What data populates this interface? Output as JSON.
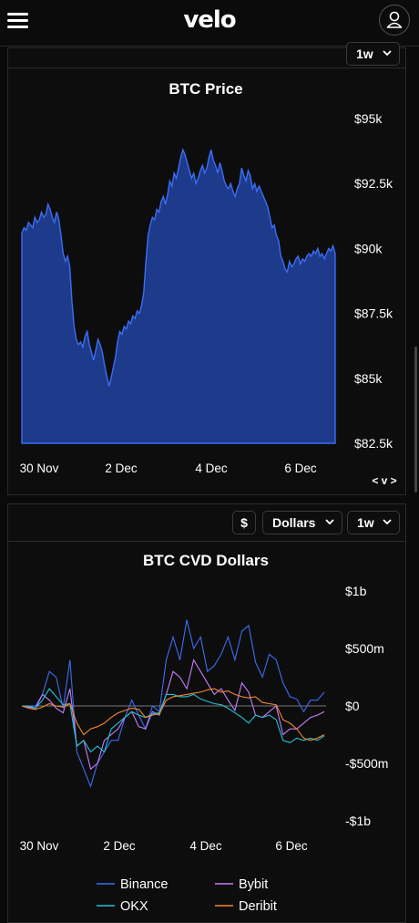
{
  "app": {
    "logo": "velo"
  },
  "icons": {
    "menu": "hamburger-menu-icon",
    "profile": "user-profile-icon",
    "chevron": "chevron-down-icon"
  },
  "panel1": {
    "timeframe": "1w"
  },
  "panel2": {
    "currency_symbol": "$",
    "unit": "Dollars",
    "timeframe": "1w"
  },
  "nav_arrows": "< v >",
  "colors": {
    "background": "#0a0a0a",
    "price_fill": "#1e3a8a",
    "price_line": "#3b6ef5",
    "binance": "#3b6ef5",
    "bybit": "#c77dff",
    "okx": "#22c3d6",
    "deribit": "#f08a2c"
  },
  "chart_data": [
    {
      "type": "area",
      "title": "BTC Price",
      "x_ticks": [
        "30 Nov",
        "2 Dec",
        "4 Dec",
        "6 Dec"
      ],
      "y_ticks": [
        "$95k",
        "$92.5k",
        "$90k",
        "$87.5k",
        "$85k",
        "$82.5k"
      ],
      "ylim": [
        82500,
        95000
      ],
      "series": [
        {
          "values": [
            90600,
            90800,
            90700,
            91000,
            90900,
            90800,
            91200,
            91000,
            91100,
            91400,
            91200,
            91300,
            91700,
            91500,
            91200,
            91000,
            91400,
            91100,
            90500,
            89800,
            89500,
            89700,
            89300,
            88000,
            87000,
            86500,
            86300,
            86400,
            86200,
            86600,
            86800,
            86300,
            86000,
            85700,
            86100,
            86500,
            86300,
            86000,
            85500,
            85100,
            84700,
            85000,
            85400,
            85800,
            86400,
            86800,
            86700,
            87000,
            86900,
            87200,
            87100,
            87400,
            87300,
            87600,
            87500,
            87800,
            88300,
            89500,
            90500,
            90900,
            91200,
            91100,
            91500,
            91400,
            91800,
            92000,
            91700,
            92100,
            92600,
            92400,
            92900,
            92700,
            93100,
            93500,
            93800,
            93600,
            93300,
            93000,
            92700,
            92900,
            92500,
            92700,
            93000,
            93200,
            92900,
            93100,
            93500,
            93800,
            93400,
            93200,
            92900,
            93300,
            93000,
            92600,
            92400,
            92300,
            92500,
            92200,
            92000,
            92300,
            92500,
            93100,
            92800,
            92600,
            93000,
            92800,
            92300,
            92500,
            92200,
            92400,
            92200,
            92000,
            91800,
            91600,
            91200,
            90800,
            90900,
            90500,
            90300,
            89700,
            89500,
            89200,
            89100,
            89500,
            89300,
            89400,
            89600,
            89700,
            89400,
            89600,
            89500,
            89700,
            89800,
            89700,
            89900,
            89800,
            90000,
            89700,
            89800,
            89600,
            89800,
            90000,
            89900,
            90100,
            89800
          ]
        }
      ]
    },
    {
      "type": "line",
      "title": "BTC CVD Dollars",
      "x_ticks": [
        "30 Nov",
        "2 Dec",
        "4 Dec",
        "6 Dec"
      ],
      "y_ticks": [
        "$1b",
        "$500m",
        "$0",
        "-$500m",
        "-$1b"
      ],
      "ylim": [
        -1000000000,
        1000000000
      ],
      "series": [
        {
          "name": "Binance",
          "values": [
            0,
            -10,
            0,
            100,
            300,
            250,
            -20,
            400,
            -400,
            -550,
            -700,
            -500,
            -400,
            -300,
            -300,
            -100,
            50,
            -80,
            -200,
            0,
            -50,
            400,
            600,
            400,
            750,
            500,
            600,
            300,
            350,
            450,
            600,
            400,
            650,
            700,
            380,
            250,
            450,
            400,
            200,
            80,
            60,
            -50,
            50,
            50,
            120
          ]
        },
        {
          "name": "Bybit",
          "values": [
            0,
            -10,
            -20,
            100,
            50,
            -20,
            -60,
            150,
            -350,
            -300,
            -550,
            -500,
            -300,
            -250,
            -200,
            -100,
            -50,
            -180,
            -200,
            -50,
            -80,
            100,
            300,
            250,
            150,
            400,
            300,
            200,
            100,
            150,
            50,
            -40,
            200,
            120,
            -80,
            -100,
            -50,
            0,
            -250,
            -200,
            -200,
            -150,
            -100,
            -80,
            -50
          ]
        },
        {
          "name": "OKX",
          "values": [
            0,
            0,
            -20,
            50,
            150,
            80,
            10,
            20,
            -350,
            -300,
            -400,
            -350,
            -400,
            -200,
            -150,
            -100,
            -50,
            -80,
            -100,
            -70,
            -60,
            100,
            100,
            80,
            80,
            100,
            60,
            40,
            20,
            10,
            -20,
            -60,
            -100,
            -150,
            -80,
            -100,
            -80,
            -120,
            -300,
            -320,
            -280,
            -300,
            -280,
            -300,
            -260
          ]
        },
        {
          "name": "Deribit",
          "values": [
            0,
            -20,
            -30,
            -10,
            20,
            0,
            -10,
            20,
            -150,
            -250,
            -200,
            -180,
            -150,
            -100,
            -60,
            -40,
            -20,
            -30,
            -100,
            -80,
            -70,
            50,
            80,
            90,
            100,
            110,
            120,
            140,
            150,
            120,
            130,
            100,
            80,
            70,
            80,
            30,
            20,
            10,
            -120,
            -150,
            -200,
            -280,
            -300,
            -280,
            -250
          ]
        }
      ],
      "zero_line": "$0",
      "legend_position": "bottom"
    }
  ]
}
